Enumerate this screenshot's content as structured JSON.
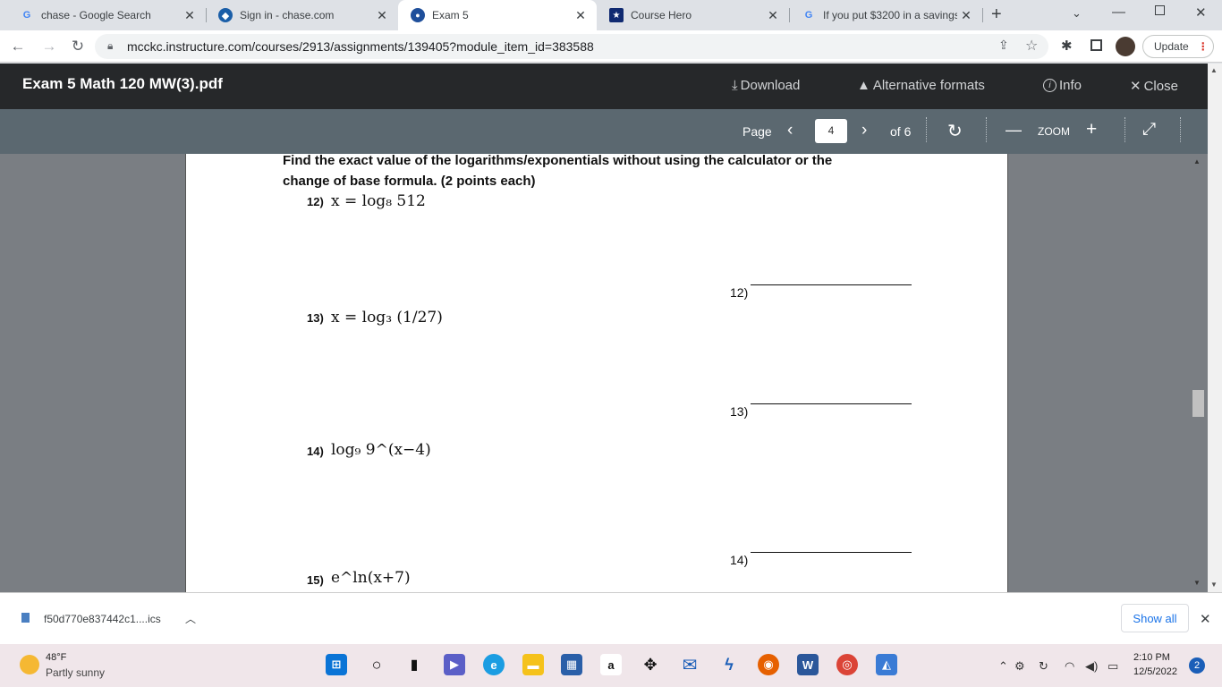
{
  "tabs": [
    {
      "title": "chase - Google Search",
      "favicon": "google-icon"
    },
    {
      "title": "Sign in - chase.com",
      "favicon": "chase-icon"
    },
    {
      "title": "Exam 5",
      "favicon": "canvas-icon"
    },
    {
      "title": "Course Hero",
      "favicon": "coursehero-icon"
    },
    {
      "title": "If you put $3200 in a savings",
      "favicon": "google-icon"
    }
  ],
  "address_bar": {
    "url": "mcckc.instructure.com/courses/2913/assignments/139405?module_item_id=383588"
  },
  "update_label": "Update",
  "viewer": {
    "doc_title": "Exam 5 Math 120 MW(3).pdf",
    "download": "Download",
    "alt_formats": "Alternative formats",
    "info": "Info",
    "close": "Close"
  },
  "pager": {
    "page_label": "Page",
    "current_page": "4",
    "of_label": "of 6",
    "zoom_label": "ZOOM"
  },
  "document": {
    "instruction_line1": "Find the exact value of the logarithms/exponentials without using the calculator or the",
    "instruction_line2": "change of base formula. (2 points each)",
    "questions": [
      {
        "num": "12)",
        "expr": "x = log₈ 512",
        "answer_label": "12)"
      },
      {
        "num": "13)",
        "expr": "x = log₃ (1/27)",
        "answer_label": "13)"
      },
      {
        "num": "14)",
        "expr": "log₉ 9^(x−4)",
        "answer_label": "14)"
      },
      {
        "num": "15)",
        "expr": "e^ln(x+7)"
      }
    ]
  },
  "download_bar": {
    "filename": "f50d770e837442c1....ics",
    "show_all": "Show all"
  },
  "taskbar": {
    "weather_temp": "48°F",
    "weather_desc": "Partly sunny",
    "time": "2:10 PM",
    "date": "12/5/2022",
    "notifications": "2"
  }
}
